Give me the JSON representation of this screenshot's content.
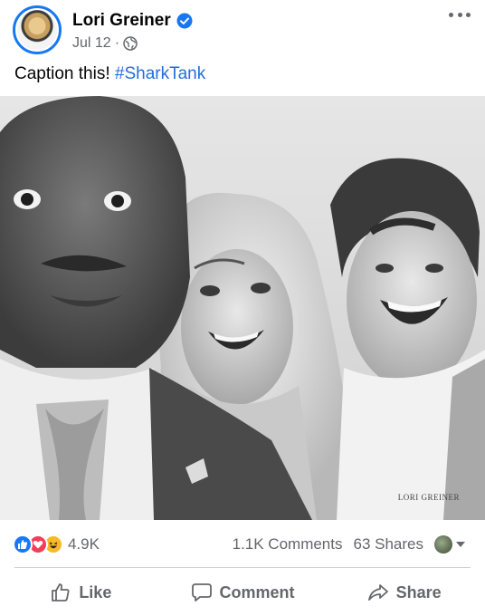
{
  "post": {
    "author": "Lori Greiner",
    "date": "Jul 12",
    "separator": "·",
    "caption_text": "Caption this! ",
    "caption_hashtag": "#SharkTank",
    "watermark": "LORI GREINER"
  },
  "stats": {
    "reaction_count": "4.9K",
    "comments": "1.1K Comments",
    "shares": "63 Shares"
  },
  "actions": {
    "like_label": "Like",
    "comment_label": "Comment",
    "share_label": "Share"
  },
  "icons": {
    "verified": "verified-badge-icon",
    "privacy": "globe-icon",
    "more": "more-options-icon",
    "like": "thumbs-up-icon",
    "comment": "comment-bubble-icon",
    "share": "share-arrow-icon"
  },
  "colors": {
    "accent": "#1877f2",
    "hashtag": "#216fdb",
    "secondary_text": "#65676b",
    "love": "#f33e58",
    "haha": "#f7b928"
  }
}
